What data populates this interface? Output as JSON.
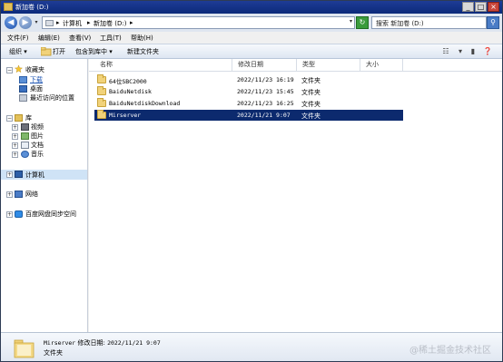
{
  "window": {
    "title": "新加卷 (D:)",
    "controls": {
      "minimize": "_",
      "maximize": "□",
      "close": "×"
    }
  },
  "address": {
    "crumbs": [
      "计算机",
      "新加卷 (D:)"
    ],
    "separator": "▸",
    "search_placeholder": "搜索 新加卷 (D:)"
  },
  "menu": [
    "文件(F)",
    "编辑(E)",
    "查看(V)",
    "工具(T)",
    "帮助(H)"
  ],
  "commands": {
    "organize": "组织 ▾",
    "open": "打开",
    "include_library": "包含到库中 ▾",
    "new_folder": "新建文件夹"
  },
  "nav": {
    "favorites": {
      "label": "收藏夹",
      "items": [
        "下载",
        "桌面",
        "最近访问的位置"
      ]
    },
    "libraries": {
      "label": "库",
      "items": [
        "视频",
        "图片",
        "文档",
        "音乐"
      ]
    },
    "computer": "计算机",
    "network": "网络",
    "baidu": "百度网盘同步空间"
  },
  "columns": [
    "名称",
    "修改日期",
    "类型",
    "大小"
  ],
  "files": [
    {
      "name": "64位SBC2000",
      "date": "2022/11/23 16:19",
      "type": "文件夹",
      "size": ""
    },
    {
      "name": "BaiduNetdisk",
      "date": "2022/11/23 15:45",
      "type": "文件夹",
      "size": ""
    },
    {
      "name": "BaiduNetdiskDownload",
      "date": "2022/11/23 16:25",
      "type": "文件夹",
      "size": ""
    },
    {
      "name": "Mirserver",
      "date": "2022/11/21 9:07",
      "type": "文件夹",
      "size": ""
    }
  ],
  "selected_index": 3,
  "details": {
    "name": "Mirserver",
    "modified_label": "修改日期:",
    "modified_value": "2022/11/21 9:07",
    "type": "文件夹"
  },
  "watermark": "@稀土掘金技术社区",
  "colors": {
    "title_bar": "#0c2a7a",
    "selection": "#0c2a6e",
    "folder": "#f1d27a"
  }
}
